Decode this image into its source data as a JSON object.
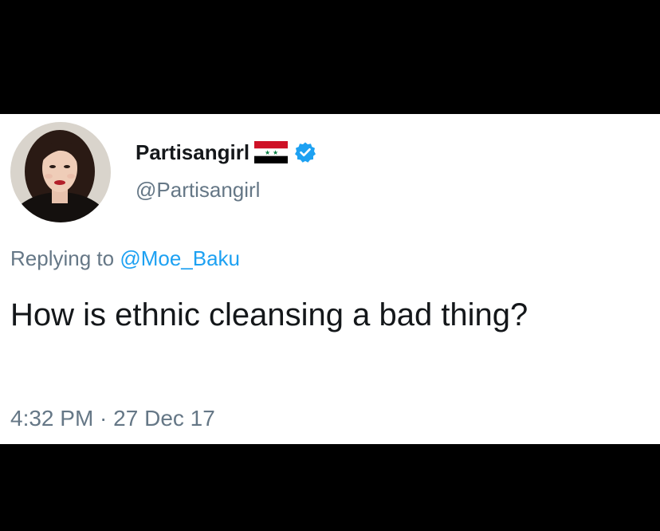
{
  "tweet": {
    "display_name": "Partisangirl",
    "handle": "@Partisangirl",
    "flag_icon": "syria-flag-icon",
    "verified_icon": "verified-badge-icon",
    "reply_prefix": "Replying to ",
    "reply_to": "@Moe_Baku",
    "text": "How is ethnic cleansing a bad thing?",
    "time": "4:32 PM",
    "separator": " · ",
    "date": "27 Dec 17"
  },
  "colors": {
    "frame_background": "#000000",
    "card_background": "#ffffff",
    "link": "#1da1f2",
    "secondary_text": "#657786",
    "primary_text": "#14171a",
    "verified_badge": "#1da1f2"
  }
}
